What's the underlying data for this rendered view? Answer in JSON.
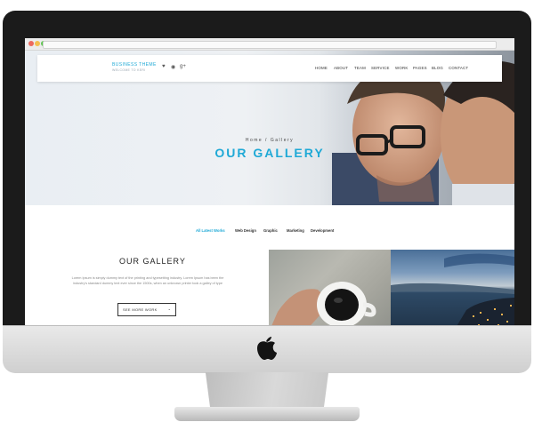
{
  "site": {
    "brand": "BUSINESS THEME",
    "tagline": "WELCOME TO KERI",
    "social": [
      "♥",
      "◉",
      "g+"
    ],
    "nav": [
      "HOME",
      "ABOUT",
      "TEAM",
      "SERVICE",
      "WORK",
      "PAGES",
      "BLOG",
      "CONTACT"
    ]
  },
  "hero": {
    "breadcrumb": "Home / Gallery",
    "title": "OUR GALLERY"
  },
  "filters": [
    "All Latest Works",
    "Web Design",
    "Graphic",
    "Marketing",
    "Development"
  ],
  "section": {
    "title": "OUR GALLERY",
    "text": "Lorem Ipsum is simply dummy text of the printing and typesetting industry. Lorem Ipsum has been the industry's standard dummy text ever since the 1500s, when an unknown printer took a galley of type",
    "button": "SEE MORE WORK",
    "button_chevron": "⌄"
  },
  "colors": {
    "accent": "#1fa9d6",
    "monitor_bezel": "#1b1b1b"
  },
  "icons": {
    "monitor_logo": "apple-icon",
    "button_chevron": "chevron-down-icon"
  }
}
